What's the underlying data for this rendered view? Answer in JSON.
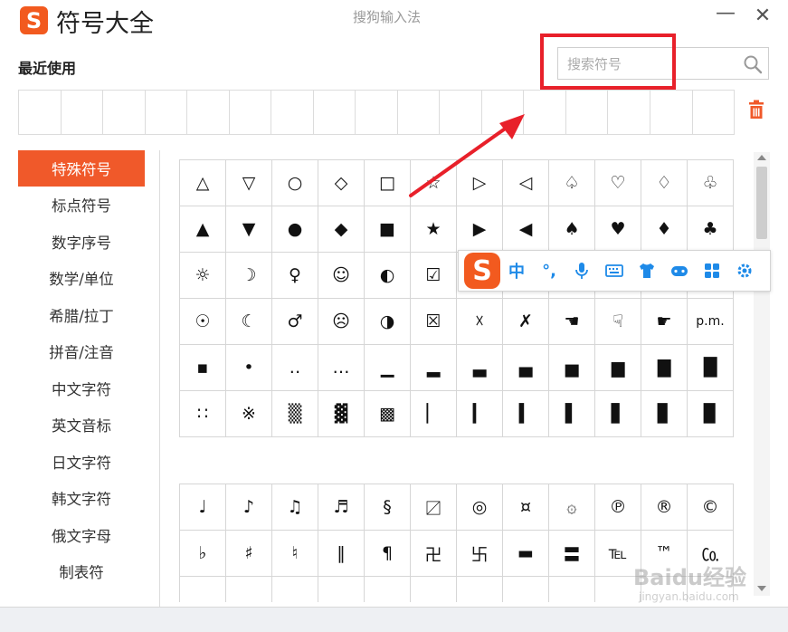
{
  "window": {
    "title": "符号大全",
    "subtitle": "搜狗输入法",
    "logo_letter": "S",
    "minimize_symbol": "—",
    "close_symbol": "✕"
  },
  "recent": {
    "label": "最近使用",
    "cells": [
      "",
      "",
      "",
      "",
      "",
      "",
      "",
      "",
      "",
      "",
      "",
      "",
      "",
      "",
      "",
      "",
      ""
    ]
  },
  "search": {
    "placeholder": "搜索符号",
    "value": ""
  },
  "sidebar": {
    "items": [
      {
        "label": "特殊符号",
        "active": true
      },
      {
        "label": "标点符号",
        "active": false
      },
      {
        "label": "数字序号",
        "active": false
      },
      {
        "label": "数学/单位",
        "active": false
      },
      {
        "label": "希腊/拉丁",
        "active": false
      },
      {
        "label": "拼音/注音",
        "active": false
      },
      {
        "label": "中文字符",
        "active": false
      },
      {
        "label": "英文音标",
        "active": false
      },
      {
        "label": "日文字符",
        "active": false
      },
      {
        "label": "韩文字符",
        "active": false
      },
      {
        "label": "俄文字母",
        "active": false
      },
      {
        "label": "制表符",
        "active": false
      }
    ]
  },
  "symbols_group1": [
    [
      "△",
      "▽",
      "○",
      "◇",
      "□",
      "☆",
      "▷",
      "◁",
      "♤",
      "♡",
      "♢",
      "♧"
    ],
    [
      "▲",
      "▼",
      "●",
      "◆",
      "■",
      "★",
      "▶",
      "◀",
      "♠",
      "♥",
      "♦",
      "♣"
    ],
    [
      "☼",
      "☽",
      "♀",
      "☺",
      "◐",
      "☑",
      "",
      "",
      "",
      "",
      "",
      ""
    ],
    [
      "☉",
      "☾",
      "♂",
      "☹",
      "◑",
      "☒",
      "☓",
      "✗",
      "☚",
      "☟",
      "☛",
      "p.m."
    ],
    [
      "▪",
      "•",
      "‥",
      "…",
      "▁",
      "▂",
      "▃",
      "▄",
      "▅",
      "▆",
      "▇",
      "█"
    ],
    [
      "∷",
      "※",
      "▒",
      "▓",
      "▩",
      "▏",
      "▎",
      "▍",
      "▌",
      "▋",
      "▊",
      "▉"
    ]
  ],
  "symbols_group2": [
    [
      "♩",
      "♪",
      "♫",
      "♬",
      "§",
      "〼",
      "◎",
      "¤",
      "۞",
      "℗",
      "®",
      "©"
    ],
    [
      "♭",
      "♯",
      "♮",
      "‖",
      "¶",
      "卍",
      "卐",
      "▬",
      "〓",
      "℡",
      "™",
      "㏇"
    ],
    [
      "",
      "",
      "",
      "",
      "",
      "",
      "",
      "",
      "",
      "",
      "",
      ""
    ]
  ],
  "ime_toolbar": {
    "logo": "S",
    "lang": "中",
    "punct": "°,"
  },
  "watermark": {
    "text": "Baidu经验",
    "sub": "jingyan.baidu.com"
  },
  "colors": {
    "accent": "#f0592a",
    "annotation": "#e8202a",
    "ime_blue": "#1e8ae8"
  }
}
